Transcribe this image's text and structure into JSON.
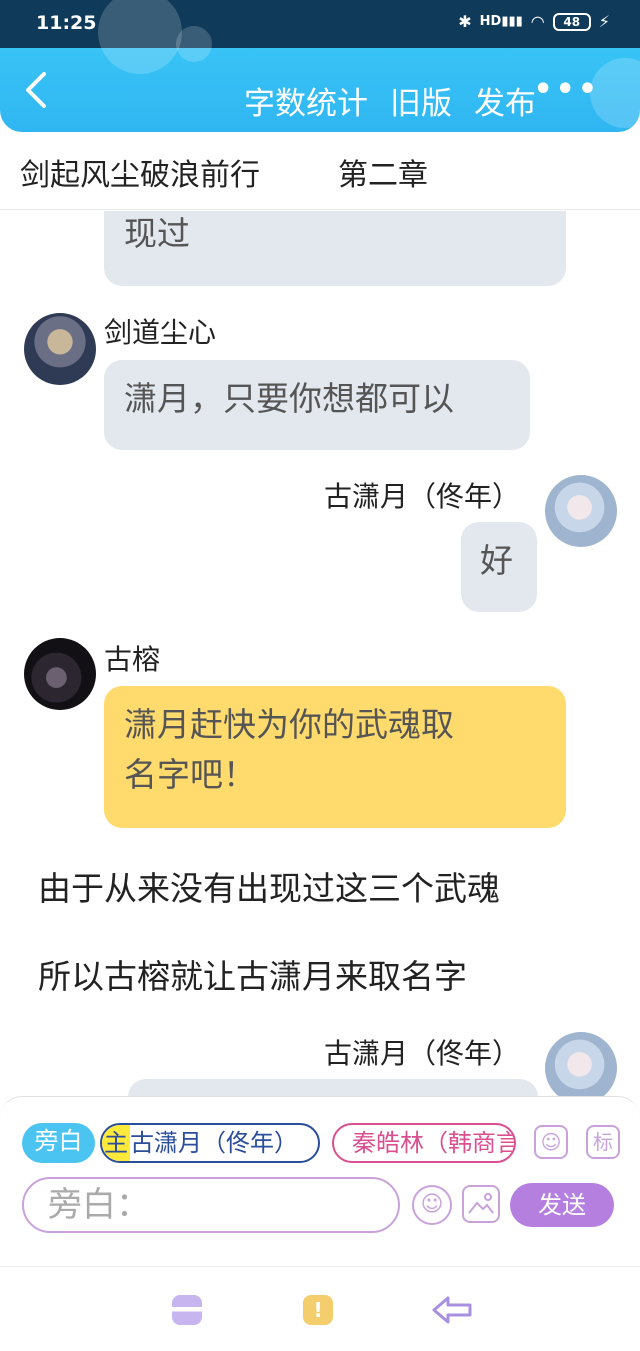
{
  "status_bar": {
    "time": "11:25",
    "battery": "48",
    "network": "HD"
  },
  "header": {
    "btn_stats": "字数统计",
    "btn_old": "旧版",
    "btn_publish": "发布",
    "more": "•••"
  },
  "chapter": {
    "title": "剑起风尘破浪前行",
    "label": "第二章"
  },
  "messages": {
    "m0": {
      "text": "现过"
    },
    "m1": {
      "sender": "剑道尘心",
      "text": "潇月，只要你想都可以"
    },
    "m2": {
      "sender": "古潇月（佟年）",
      "text": "好"
    },
    "m3": {
      "sender": "古榕",
      "line1": "潇月赶快为你的武魂取",
      "line2": "名字吧！"
    },
    "n1": {
      "text": "由于从来没有出现过这三个武魂"
    },
    "n2": {
      "text": "所以古榕就让古潇月来取名字"
    },
    "m4": {
      "sender": "古潇月（佟年）"
    }
  },
  "composer": {
    "chip_narrator": "旁白",
    "chip_main_tag": "主",
    "chip_main_name": "古潇月（佟年）",
    "chip_other": "秦皓林（韩商言",
    "tag_label": "标",
    "placeholder": "旁白：",
    "send": "发送"
  },
  "colors": {
    "accent": "#38c3f5",
    "send": "#b57fe0",
    "yellow_bubble": "#ffdb6e"
  }
}
